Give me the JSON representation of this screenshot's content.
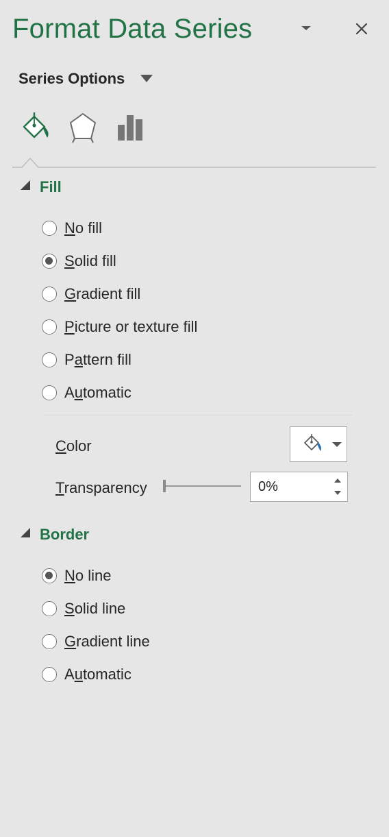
{
  "pane": {
    "title": "Format Data Series",
    "series_options_label": "Series Options"
  },
  "icons": {
    "title_dropdown": "chevron-down-icon",
    "close": "close-icon",
    "fill_line_tab": "paint-bucket-icon",
    "effects_tab": "pentagon-icon",
    "series_options_tab": "bar-chart-icon"
  },
  "fill": {
    "header": "Fill",
    "options": [
      {
        "label": "No fill",
        "mnemonic": "N",
        "rest": "o fill",
        "checked": false
      },
      {
        "label": "Solid fill",
        "mnemonic": "S",
        "rest": "olid fill",
        "checked": true
      },
      {
        "label": "Gradient fill",
        "mnemonic": "G",
        "rest": "radient fill",
        "checked": false
      },
      {
        "label": "Picture or texture fill",
        "mnemonic": "P",
        "rest": "icture or texture fill",
        "checked": false
      },
      {
        "label": "Pattern fill",
        "pre": "P",
        "mnemonic": "a",
        "rest": "ttern fill",
        "checked": false
      },
      {
        "label": "Automatic",
        "pre": "A",
        "mnemonic": "u",
        "rest": "tomatic",
        "checked": false
      }
    ],
    "color_label": {
      "mnemonic": "C",
      "rest": "olor"
    },
    "transparency_label": {
      "mnemonic": "T",
      "rest": "ransparency"
    },
    "transparency_value": "0%",
    "transparency_level": 0
  },
  "border": {
    "header": "Border",
    "options": [
      {
        "label": "No line",
        "mnemonic": "N",
        "rest": "o line",
        "checked": true
      },
      {
        "label": "Solid line",
        "mnemonic": "S",
        "rest": "olid line",
        "checked": false
      },
      {
        "label": "Gradient line",
        "mnemonic": "G",
        "rest": "radient line",
        "checked": false
      },
      {
        "label": "Automatic",
        "pre": "A",
        "mnemonic": "u",
        "rest": "tomatic",
        "checked": false
      }
    ]
  },
  "colors": {
    "accent": "#217346",
    "fill_swatch": "#2e75b6"
  }
}
